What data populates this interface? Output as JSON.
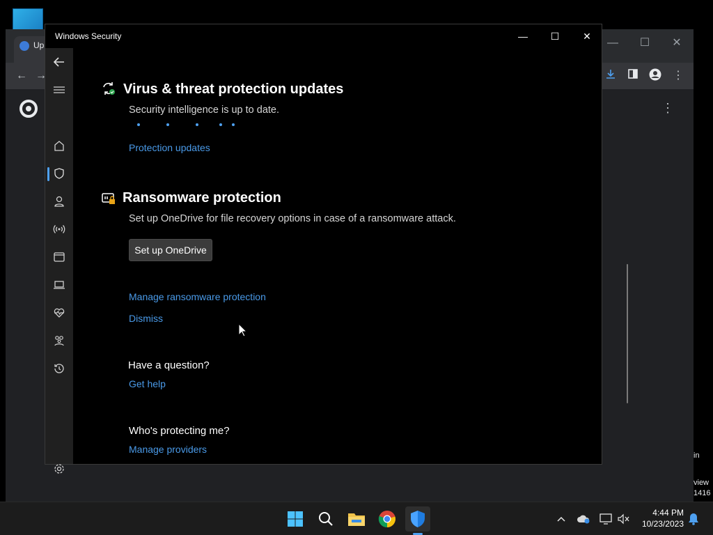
{
  "window": {
    "title": "Windows Security",
    "controls": {
      "minimize": "—",
      "maximize": "☐",
      "close": "✕"
    }
  },
  "background_app": {
    "tab_label": "Up",
    "side_text_1": "in",
    "side_text_2": "view",
    "side_text_3": "1416"
  },
  "nav": {
    "items": [
      {
        "name": "back",
        "icon": "back-arrow-icon"
      },
      {
        "name": "menu",
        "icon": "hamburger-menu-icon"
      },
      {
        "name": "home",
        "icon": "home-icon"
      },
      {
        "name": "virus-protection",
        "icon": "shield-icon",
        "selected": true
      },
      {
        "name": "account-protection",
        "icon": "person-icon"
      },
      {
        "name": "firewall",
        "icon": "wireless-antenna-icon"
      },
      {
        "name": "app-browser-control",
        "icon": "browser-window-icon"
      },
      {
        "name": "device-security",
        "icon": "laptop-icon"
      },
      {
        "name": "device-performance",
        "icon": "heart-pulse-icon"
      },
      {
        "name": "family-options",
        "icon": "family-icon"
      },
      {
        "name": "protection-history",
        "icon": "history-icon"
      },
      {
        "name": "settings",
        "icon": "gear-icon"
      }
    ]
  },
  "updates_section": {
    "title": "Virus & threat protection updates",
    "status": "Security intelligence is up to date.",
    "link": "Protection updates"
  },
  "ransomware_section": {
    "title": "Ransomware protection",
    "description": "Set up OneDrive for file recovery options in case of a ransomware attack.",
    "button": "Set up OneDrive",
    "manage_link": "Manage ransomware protection",
    "dismiss_link": "Dismiss"
  },
  "question_section": {
    "heading": "Have a question?",
    "link": "Get help"
  },
  "protecting_section": {
    "heading": "Who's protecting me?",
    "link": "Manage providers"
  },
  "taskbar": {
    "apps": [
      "windows-start-icon",
      "search-icon",
      "file-explorer-icon",
      "chrome-icon",
      "windows-security-icon"
    ],
    "time": "4:44 PM",
    "date": "10/23/2023",
    "tray": [
      "chevron-up-icon",
      "onedrive-icon",
      "display-icon",
      "volume-muted-icon",
      "notification-bell-icon"
    ]
  },
  "colors": {
    "accent": "#4ea0f0",
    "link": "#4a9ae8",
    "nav_bg": "#202020",
    "window_bg": "#000000"
  }
}
